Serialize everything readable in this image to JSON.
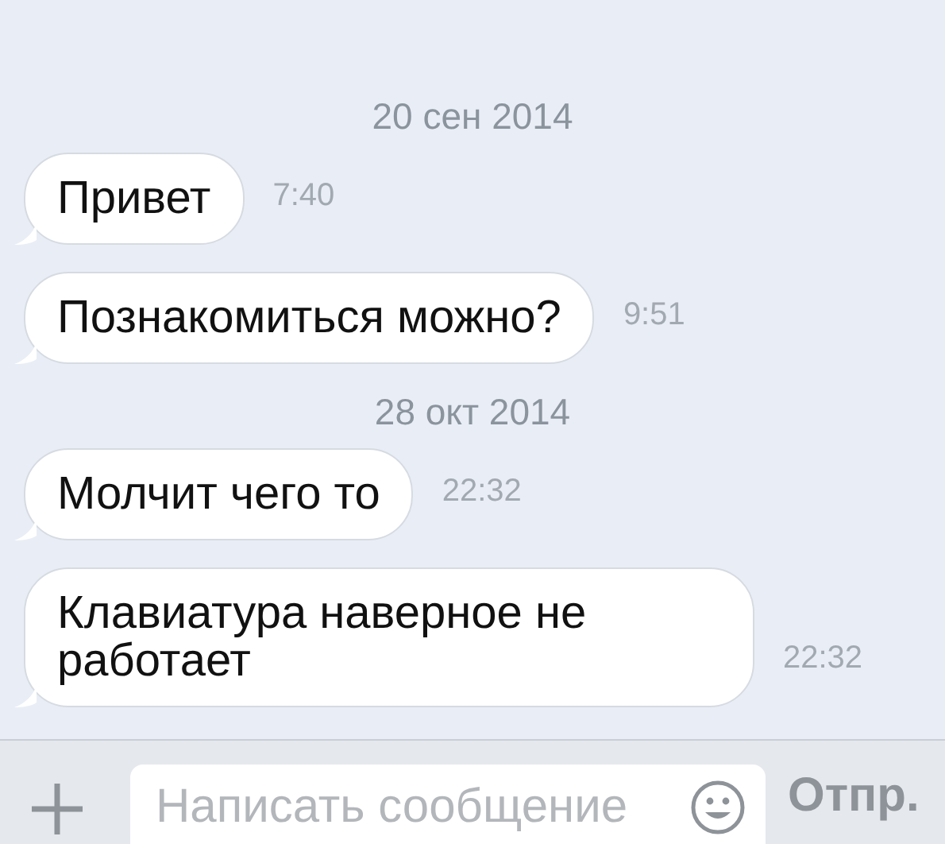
{
  "messages": [
    {
      "kind": "date",
      "text": "20 сен 2014"
    },
    {
      "kind": "message",
      "text": "Привет",
      "time": "7:40"
    },
    {
      "kind": "message",
      "text": "Познакомиться можно?",
      "time": "9:51"
    },
    {
      "kind": "date",
      "text": "28 окт 2014"
    },
    {
      "kind": "message",
      "text": "Молчит чего то",
      "time": "22:32"
    },
    {
      "kind": "message",
      "text": "Клавиатура наверное не работает",
      "time": "22:32"
    }
  ],
  "composer": {
    "placeholder": "Написать сообщение",
    "send_label": "Отпр."
  }
}
